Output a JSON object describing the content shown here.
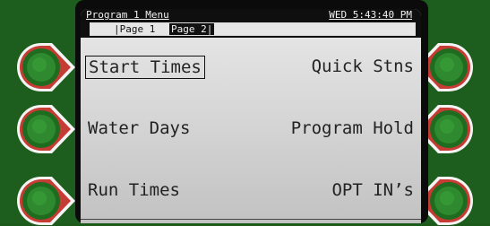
{
  "titlebar": {
    "menu_title": "Program 1 Menu",
    "clock": "WED 5:43:40 PM"
  },
  "tabs": [
    {
      "label": "|Page 1",
      "active": true
    },
    {
      "label": "Page 2|",
      "active": false
    }
  ],
  "menu": {
    "left": [
      {
        "label": "Start Times",
        "selected": true
      },
      {
        "label": "Water Days"
      },
      {
        "label": "Run Times"
      }
    ],
    "right": [
      {
        "label": "Quick Stns"
      },
      {
        "label": "Program Hold"
      },
      {
        "label": "OPT IN’s"
      }
    ]
  },
  "colors": {
    "panel_green": "#1b5a1b",
    "softkey_ring": "#c43c34",
    "screen_bg": "#d9d9d9"
  },
  "icons": {
    "softkey": "round-green-button"
  }
}
